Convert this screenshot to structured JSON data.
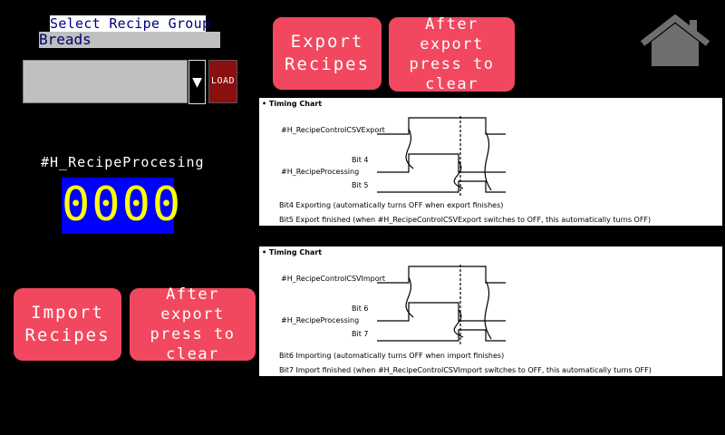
{
  "recipe": {
    "title": "Select Recipe Group",
    "selected_group": "Breads",
    "load_label": "LOAD",
    "dropdown_arrow": "▼"
  },
  "processing": {
    "label": "#H_RecipeProcesing",
    "value": "0000"
  },
  "buttons": {
    "export": "Export\nRecipes",
    "export_clear": "After export\npress to\nclear",
    "import": "Import\nRecipes",
    "import_clear": "After export\npress to\nclear",
    "home_icon": "home-icon"
  },
  "export_chart": {
    "heading": "• Timing Chart",
    "signal_main": "#H_RecipeControlCSVExport",
    "signal_processing": "#H_RecipeProcessing",
    "bit_a": "Bit 4",
    "bit_b": "Bit 5",
    "note1": "Bit4  Exporting  (automatically turns OFF when export finishes)",
    "note2": "Bit5  Export finished  (when #H_RecipeControlCSVExport switches to OFF, this automatically turns OFF)"
  },
  "import_chart": {
    "heading": "• Timing Chart",
    "signal_main": "#H_RecipeControlCSVImport",
    "signal_processing": "#H_RecipeProcessing",
    "bit_a": "Bit 6",
    "bit_b": "Bit 7",
    "note1": "Bit6  Importing  (automatically turns OFF when import finishes)",
    "note2": "Bit7  Import finished  (when #H_RecipeControlCSVImport switches to OFF, this automatically turns OFF)"
  },
  "colors": {
    "button": "#f1485f",
    "display_bg": "#0000ff",
    "display_fg": "#ffff00",
    "load_bg": "#8a0f0f"
  }
}
